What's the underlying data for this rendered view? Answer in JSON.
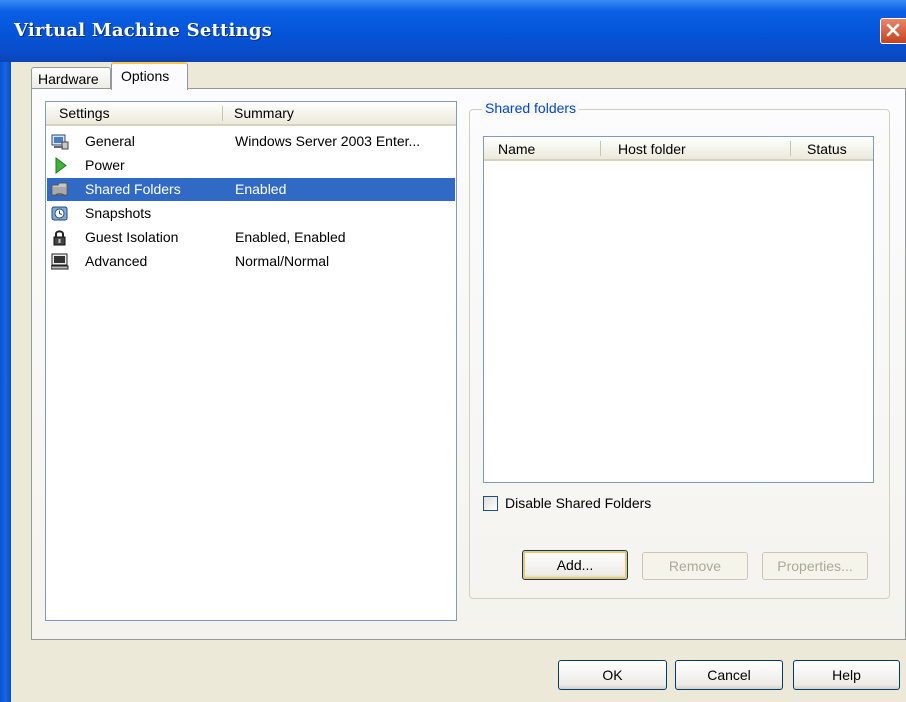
{
  "window": {
    "title": "Virtual Machine Settings"
  },
  "tabs": [
    {
      "label": "Hardware",
      "selected": false
    },
    {
      "label": "Options",
      "selected": true
    }
  ],
  "settings_list": {
    "columns": [
      "Settings",
      "Summary"
    ],
    "rows": [
      {
        "name": "General",
        "summary": "Windows Server 2003 Enter...",
        "icon": "general-icon",
        "selected": false
      },
      {
        "name": "Power",
        "summary": "",
        "icon": "power-icon",
        "selected": false
      },
      {
        "name": "Shared Folders",
        "summary": "Enabled",
        "icon": "shared-folders-icon",
        "selected": true
      },
      {
        "name": "Snapshots",
        "summary": "",
        "icon": "snapshots-icon",
        "selected": false
      },
      {
        "name": "Guest Isolation",
        "summary": "Enabled, Enabled",
        "icon": "lock-icon",
        "selected": false
      },
      {
        "name": "Advanced",
        "summary": "Normal/Normal",
        "icon": "advanced-icon",
        "selected": false
      }
    ]
  },
  "shared_folders": {
    "group_title": "Shared folders",
    "columns": [
      "Name",
      "Host folder",
      "Status"
    ],
    "rows": [],
    "disable_checkbox": {
      "label": "Disable Shared Folders",
      "checked": false
    },
    "buttons": {
      "add": "Add...",
      "remove": "Remove",
      "properties": "Properties..."
    }
  },
  "footer": {
    "ok": "OK",
    "cancel": "Cancel",
    "help": "Help"
  },
  "colors": {
    "titlebar": "#0454d8",
    "selection": "#316ac5",
    "face": "#ece9d8",
    "link": "#0046d5"
  }
}
